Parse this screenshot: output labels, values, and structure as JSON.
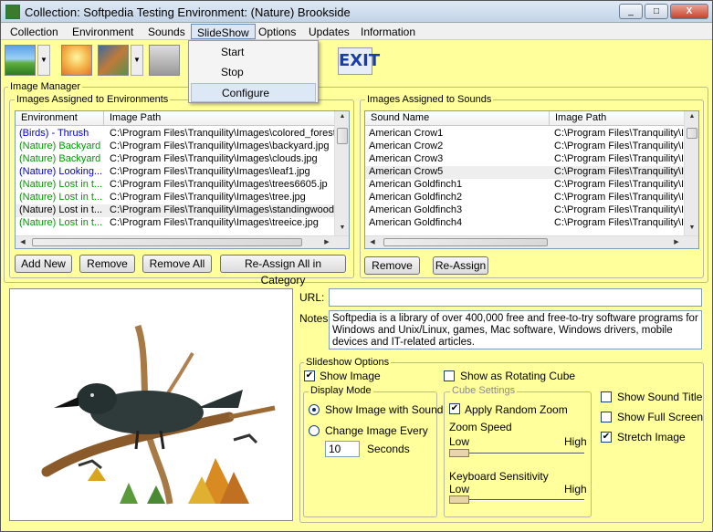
{
  "window": {
    "title": "Collection: Softpedia Testing    Environment: (Nature) Brookside",
    "min": "_",
    "max": "□",
    "close": "X"
  },
  "menu": [
    "Collection",
    "Environment",
    "Sounds",
    "SlideShow",
    "Options",
    "Updates",
    "Information"
  ],
  "slideshow_menu": [
    "Start",
    "Stop",
    "Configure"
  ],
  "toolbar": {
    "exit_label": "EXIT",
    "arrow": "▼"
  },
  "image_manager": {
    "title": "Image Manager",
    "env_group": {
      "title": "Images Assigned to Environments",
      "headers": [
        "Environment",
        "Image Path"
      ],
      "rows": [
        {
          "env": "(Birds) - Thrush",
          "path": "C:\\Program Files\\Tranquility\\Images\\colored_forest.",
          "color": "#0000cc"
        },
        {
          "env": "(Nature) Backyard",
          "path": "C:\\Program Files\\Tranquility\\Images\\backyard.jpg",
          "color": "#009900"
        },
        {
          "env": "(Nature) Backyard",
          "path": "C:\\Program Files\\Tranquility\\Images\\clouds.jpg",
          "color": "#009900"
        },
        {
          "env": "(Nature) Looking...",
          "path": "C:\\Program Files\\Tranquility\\Images\\leaf1.jpg",
          "color": "#0000cc"
        },
        {
          "env": "(Nature) Lost in t...",
          "path": "C:\\Program Files\\Tranquility\\Images\\trees6605.jp",
          "color": "#009900"
        },
        {
          "env": "(Nature) Lost in t...",
          "path": "C:\\Program Files\\Tranquility\\Images\\tree.jpg",
          "color": "#009900"
        },
        {
          "env": "(Nature) Lost in t...",
          "path": "C:\\Program Files\\Tranquility\\Images\\standingwood.j",
          "color": "#000000"
        },
        {
          "env": "(Nature) Lost in t...",
          "path": "C:\\Program Files\\Tranquility\\Images\\treeice.jpg",
          "color": "#009900"
        }
      ],
      "buttons": [
        "Add New",
        "Remove",
        "Remove All",
        "Re-Assign All in Category"
      ]
    },
    "snd_group": {
      "title": "Images Assigned to Sounds",
      "headers": [
        "Sound Name",
        "Image Path"
      ],
      "rows": [
        {
          "name": "American Crow1",
          "path": "C:\\Program Files\\Tranquility\\Ir"
        },
        {
          "name": "American Crow2",
          "path": "C:\\Program Files\\Tranquility\\Ir"
        },
        {
          "name": "American Crow3",
          "path": "C:\\Program Files\\Tranquility\\Ir"
        },
        {
          "name": "American Crow5",
          "path": "C:\\Program Files\\Tranquility\\Ir"
        },
        {
          "name": "American Goldfinch1",
          "path": "C:\\Program Files\\Tranquility\\Ir"
        },
        {
          "name": "American Goldfinch2",
          "path": "C:\\Program Files\\Tranquility\\Ir"
        },
        {
          "name": "American Goldfinch3",
          "path": "C:\\Program Files\\Tranquility\\Ir"
        },
        {
          "name": "American Goldfinch4",
          "path": "C:\\Program Files\\Tranquility\\Ir"
        }
      ],
      "buttons": [
        "Remove",
        "Re-Assign"
      ]
    }
  },
  "details": {
    "url_label": "URL:",
    "url_value": "",
    "notes_label": "Notes:",
    "notes_value": "Softpedia is a library of over 400,000 free and free-to-try software programs for Windows and Unix/Linux, games, Mac software, Windows drivers, mobile devices and IT-related articles."
  },
  "slideshow_options": {
    "title": "Slideshow Options",
    "show_image": "Show Image",
    "show_cube": "Show as Rotating Cube",
    "display_mode": {
      "title": "Display Mode",
      "with_sound": "Show Image with Sound",
      "change_every": "Change Image Every",
      "seconds_value": "10",
      "seconds_label": "Seconds"
    },
    "cube": {
      "title": "Cube Settings",
      "random_zoom": "Apply Random Zoom",
      "zoom_speed": "Zoom Speed",
      "low": "Low",
      "high": "High",
      "kb_sens": "Keyboard Sensitivity"
    },
    "show_sound_title": "Show Sound Title",
    "show_full_screen": "Show Full Screen",
    "stretch_image": "Stretch Image"
  },
  "colors": {
    "background": "#ffff9c",
    "accent": "#1a3da8"
  }
}
